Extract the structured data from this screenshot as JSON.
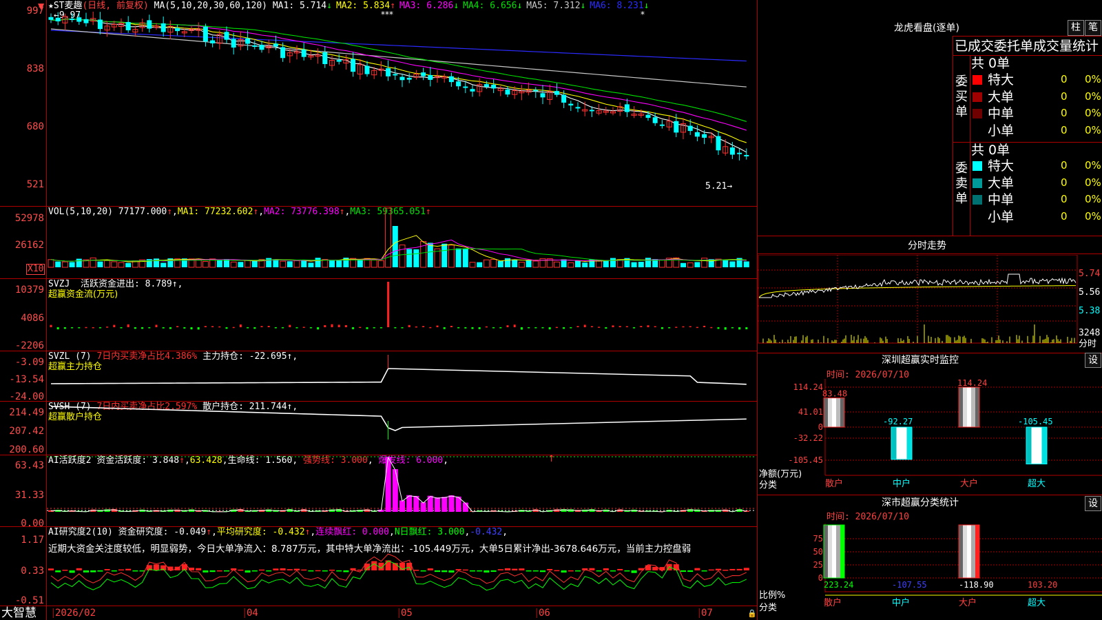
{
  "main": {
    "title_star": "★",
    "stock_name": "ST麦趣",
    "period_info": "(日线, 前复权)",
    "ma_label": "MA(5,10,20,30,60,120)",
    "ma": [
      {
        "name": "MA1",
        "value": "5.714",
        "arrow": "↓",
        "color": "#ffffff"
      },
      {
        "name": "MA2",
        "value": "5.834",
        "arrow": "↑",
        "color": "#ffff00"
      },
      {
        "name": "MA3",
        "value": "6.286",
        "arrow": "↓",
        "color": "#ff00ff"
      },
      {
        "name": "MA4",
        "value": "6.656",
        "arrow": "↓",
        "color": "#00e000"
      },
      {
        "name": "MA5",
        "value": "7.312",
        "arrow": "↓",
        "color": "#c8c8c8"
      },
      {
        "name": "MA6",
        "value": "8.231",
        "arrow": "↓",
        "color": "#2b2bff"
      }
    ],
    "y_ticks": [
      "997",
      "838",
      "680",
      "521"
    ],
    "high_label": "9.97",
    "low_label": "5.21",
    "markers": [
      "***",
      "*"
    ],
    "colors": {
      "up": "#ff3030",
      "down": "#00ffff",
      "ma1": "#ffffff",
      "ma2": "#ffff00",
      "ma3": "#ff00ff",
      "ma4": "#00e000",
      "ma5": "#c8c8c8",
      "ma6": "#2b2bff"
    }
  },
  "vol": {
    "label": "VOL(5,10,20)",
    "value": "77177.000",
    "ma1": "MA1: 77232.602",
    "ma2": "MA2: 73776.398",
    "ma3": "MA3: 59365.051",
    "arrow": "↑",
    "y_ticks": [
      "52978",
      "26162"
    ],
    "unit": "X10"
  },
  "svzj": {
    "label": "SVZJ",
    "text": "活跃资金进出: 8.789",
    "arrow": "↑,",
    "subtitle": "超赢资金流(万元)",
    "y_ticks": [
      "10379",
      "4086",
      "-2206"
    ]
  },
  "svzl": {
    "label": "SVZL (7)",
    "red_text": "7日内买卖净占比4.386%",
    "text": "主力持仓: -22.695",
    "arrow": "↑,",
    "subtitle": "超赢主力持仓",
    "y_ticks": [
      "-3.09",
      "-13.54",
      "-24.00"
    ]
  },
  "svsh": {
    "label": "SVSH (7)",
    "red_text": "7日内买卖净占比2.597%",
    "text": "散户持仓: 211.744",
    "arrow": "↑,",
    "subtitle": "超赢散户持仓",
    "y_ticks": [
      "214.49",
      "207.42",
      "200.60"
    ]
  },
  "ai1": {
    "label": "AI活跃度2",
    "t1": "资金活跃度: 3.848",
    "t2": "63.428",
    "t3": "生命线: 1.560",
    "t4": "强势线: 3.000",
    "t5": "爆发线: 6.000",
    "arrow": "↑",
    "y_ticks": [
      "63.43",
      "31.33",
      "0.00"
    ]
  },
  "ai2": {
    "label": "AI研究度2(10)",
    "t1": "资金研究度: -0.049",
    "t2": "平均研究度: -0.432",
    "t3": "连续飘红: 0.000",
    "t4": "N日飘红: 3.000",
    "t5": "-0.432",
    "comment": "近期大资金关注度较低，明显弱势，今日大单净流入：8.787万元，其中特大单净流出：-105.449万元，大单5日累计净出-3678.646万元，当前主力控盘弱",
    "y_ticks": [
      "1.17",
      "0.33",
      "-0.51"
    ]
  },
  "timeline": {
    "brand": "大智慧",
    "dates": [
      "2026/02",
      "04",
      "05",
      "06",
      "07"
    ]
  },
  "dragon": {
    "title": "龙虎看盘(逐单)",
    "btn1": "柱",
    "btn2": "笔",
    "header": "已成交委托单成交量统计",
    "buy_label": "委买单",
    "sell_label": "委卖单",
    "buy_total": "共 0单",
    "sell_total": "共 0单",
    "buy_rows": [
      {
        "name": "特大",
        "count": "0",
        "pct": "0%",
        "color": "#ff0000"
      },
      {
        "name": "大单",
        "count": "0",
        "pct": "0%",
        "color": "#a00000"
      },
      {
        "name": "中单",
        "count": "0",
        "pct": "0%",
        "color": "#700000"
      },
      {
        "name": "小单",
        "count": "0",
        "pct": "0%",
        "color": ""
      }
    ],
    "sell_rows": [
      {
        "name": "特大",
        "count": "0",
        "pct": "0%",
        "color": "#00ffff"
      },
      {
        "name": "大单",
        "count": "0",
        "pct": "0%",
        "color": "#009a9a"
      },
      {
        "name": "中单",
        "count": "0",
        "pct": "0%",
        "color": "#007070"
      },
      {
        "name": "小单",
        "count": "0",
        "pct": "0%",
        "color": ""
      }
    ]
  },
  "intraday": {
    "title": "分时走势",
    "prices": [
      "5.74",
      "5.56",
      "5.38"
    ],
    "vol_value": "3248",
    "vol_label": "分时"
  },
  "sz_monitor": {
    "title": "深圳超赢实时监控",
    "settings": "设",
    "time": "时间: 2026/07/10",
    "y_ticks": [
      "114.24",
      "41.01",
      "0",
      "-32.22",
      "-105.45"
    ],
    "unit": "净额(万元)",
    "cat_label": "分类",
    "categories": [
      "散户",
      "中户",
      "大户",
      "超大"
    ],
    "values": [
      83.48,
      -92.27,
      114.24,
      -105.45
    ],
    "value_labels": [
      "83.48",
      "-92.27",
      "114.24",
      "-105.45"
    ]
  },
  "sz_class": {
    "title": "深市超赢分类统计",
    "settings": "设",
    "time": "时间: 2026/07/10",
    "y_ticks": [
      "75",
      "50",
      "25",
      "0"
    ],
    "unit": "比例%",
    "cat_label": "分类",
    "categories": [
      "散户",
      "中户",
      "大户",
      "超大"
    ],
    "value_labels": [
      "223.24",
      "-107.55",
      "-118.90",
      "103.20"
    ],
    "label_colors": [
      "#00ff00",
      "#4040ff",
      "#ffffff",
      "#ff4040"
    ]
  }
}
